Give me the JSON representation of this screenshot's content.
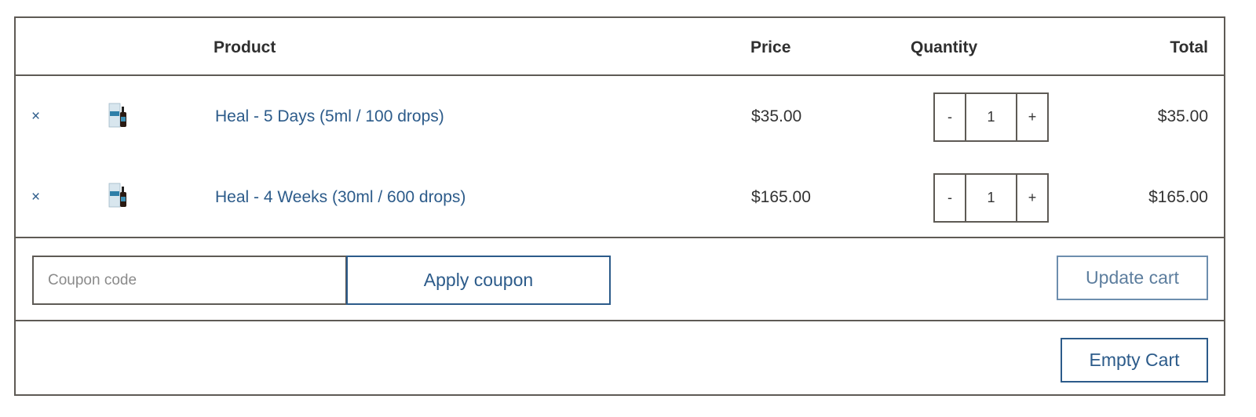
{
  "table": {
    "headers": {
      "product": "Product",
      "price": "Price",
      "quantity": "Quantity",
      "total": "Total"
    },
    "rows": [
      {
        "remove": "×",
        "thumbnail": "product-bottle-icon",
        "name": "Heal - 5 Days (5ml / 100 drops)",
        "price": "$35.00",
        "qty_minus": "-",
        "qty": "1",
        "qty_plus": "+",
        "total": "$35.00"
      },
      {
        "remove": "×",
        "thumbnail": "product-bottle-icon",
        "name": "Heal - 4 Weeks (30ml / 600 drops)",
        "price": "$165.00",
        "qty_minus": "-",
        "qty": "1",
        "qty_plus": "+",
        "total": "$165.00"
      }
    ]
  },
  "actions": {
    "coupon_placeholder": "Coupon code",
    "apply_label": "Apply coupon",
    "update_label": "Update cart",
    "empty_label": "Empty Cart"
  },
  "colors": {
    "link": "#2c5b8a",
    "border": "#5e5a55",
    "update_border": "#6d8eae"
  }
}
